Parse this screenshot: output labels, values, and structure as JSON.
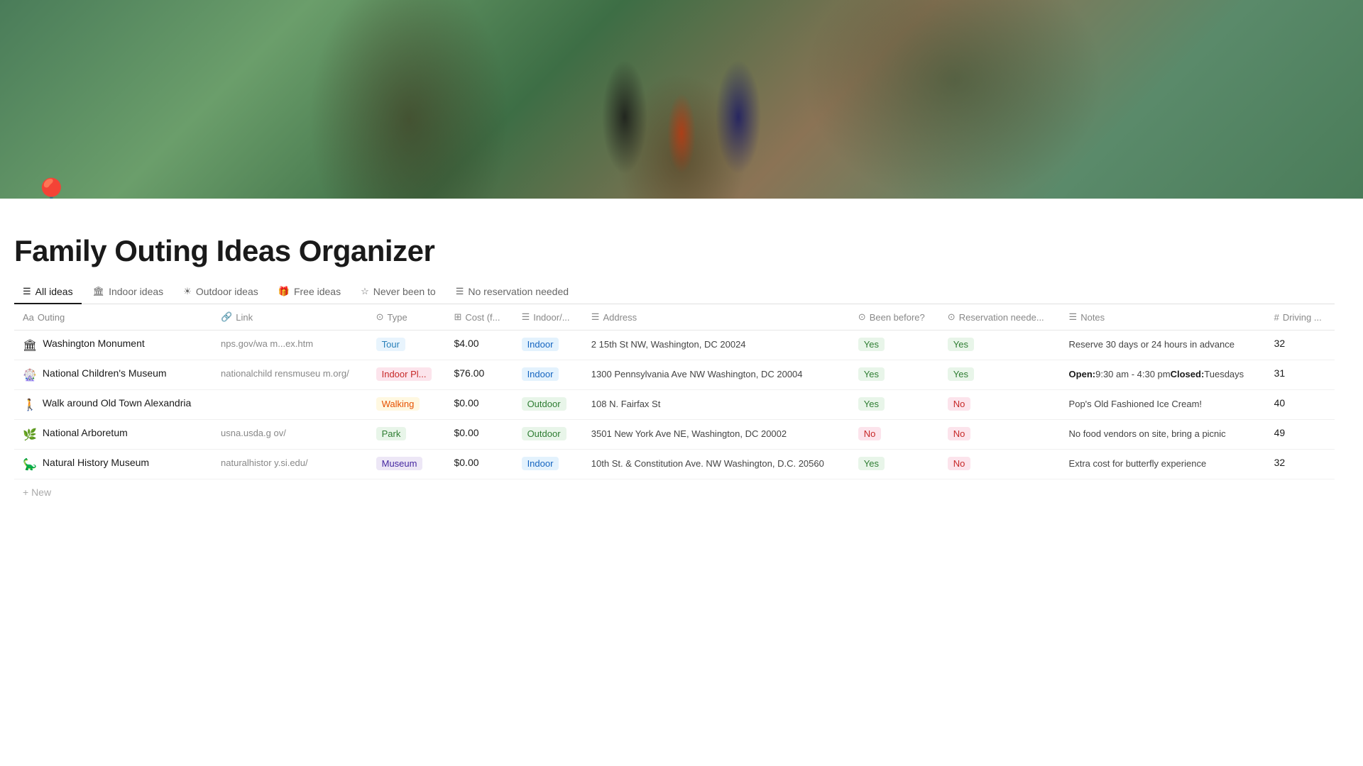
{
  "hero": {
    "alt": "Family walking on a trail"
  },
  "page": {
    "icon": "📍",
    "title": "Family Outing Ideas Organizer"
  },
  "tabs": [
    {
      "id": "all-ideas",
      "label": "All ideas",
      "icon": "☰",
      "active": true
    },
    {
      "id": "indoor-ideas",
      "label": "Indoor ideas",
      "icon": "🏛",
      "active": false
    },
    {
      "id": "outdoor-ideas",
      "label": "Outdoor ideas",
      "icon": "☀",
      "active": false
    },
    {
      "id": "free-ideas",
      "label": "Free ideas",
      "icon": "🎁",
      "active": false
    },
    {
      "id": "never-been-to",
      "label": "Never been to",
      "icon": "☆",
      "active": false
    },
    {
      "id": "no-reservation-needed",
      "label": "No reservation needed",
      "icon": "☰",
      "active": false
    }
  ],
  "columns": [
    {
      "id": "outing",
      "label": "Outing",
      "icon": "Aa"
    },
    {
      "id": "link",
      "label": "Link",
      "icon": "🔗"
    },
    {
      "id": "type",
      "label": "Type",
      "icon": "⊙"
    },
    {
      "id": "cost",
      "label": "Cost (f...",
      "icon": "⊞"
    },
    {
      "id": "indoor",
      "label": "Indoor/...",
      "icon": "☰"
    },
    {
      "id": "address",
      "label": "Address",
      "icon": "☰"
    },
    {
      "id": "been-before",
      "label": "Been before?",
      "icon": "⊙"
    },
    {
      "id": "reservation",
      "label": "Reservation neede...",
      "icon": "⊙"
    },
    {
      "id": "notes",
      "label": "Notes",
      "icon": "☰"
    },
    {
      "id": "driving",
      "label": "Driving ...",
      "icon": "#"
    }
  ],
  "rows": [
    {
      "outing": "Washington Monument",
      "outing_icon": "🏛",
      "link": "nps.gov/wa m...ex.htm",
      "link_url": "nps.gov/wamo/planyourvisit/permitsandreservations.htm",
      "type": "Tour",
      "type_class": "badge-tour",
      "cost": "$4.00",
      "indoor": "Indoor",
      "indoor_class": "badge-indoor",
      "address": "2 15th St NW, Washington, DC 20024",
      "been_before": "Yes",
      "been_before_class": "badge-yes",
      "reservation": "Yes",
      "reservation_class": "badge-yes",
      "notes": "Reserve 30 days or 24 hours in advance",
      "notes_html": "Reserve 30 days or 24 hours in advance",
      "driving": "32"
    },
    {
      "outing": "National Children's Museum",
      "outing_icon": "🎡",
      "link": "nationalchild rensmuseu m.org/",
      "link_url": "nationalchildrensmuseum.org/",
      "type": "Indoor Pl...",
      "type_class": "badge-indoor-pl",
      "cost": "$76.00",
      "indoor": "Indoor",
      "indoor_class": "badge-indoor",
      "address": "1300 Pennsylvania Ave NW Washington, DC 20004",
      "been_before": "Yes",
      "been_before_class": "badge-yes",
      "reservation": "Yes",
      "reservation_class": "badge-yes",
      "notes_html": "<strong>Open:</strong>9:30 am - 4:30 pm<strong>Closed:</strong>Tuesdays",
      "driving": "31"
    },
    {
      "outing": "Walk around Old Town Alexandria",
      "outing_icon": "🚶",
      "link": "",
      "link_url": "",
      "type": "Walking",
      "type_class": "badge-walking",
      "cost": "$0.00",
      "indoor": "Outdoor",
      "indoor_class": "badge-outdoor",
      "address": "108 N. Fairfax St",
      "been_before": "Yes",
      "been_before_class": "badge-yes",
      "reservation": "No",
      "reservation_class": "badge-no",
      "notes_html": "Pop's Old Fashioned Ice Cream!",
      "driving": "40"
    },
    {
      "outing": "National Arboretum",
      "outing_icon": "🌿",
      "link": "usna.usda.g ov/",
      "link_url": "usna.usda.gov/",
      "type": "Park",
      "type_class": "badge-park",
      "cost": "$0.00",
      "indoor": "Outdoor",
      "indoor_class": "badge-outdoor",
      "address": "3501 New York Ave NE, Washington, DC 20002",
      "been_before": "No",
      "been_before_class": "badge-no",
      "reservation": "No",
      "reservation_class": "badge-no",
      "notes_html": "No food vendors on site, bring a picnic",
      "driving": "49"
    },
    {
      "outing": "Natural History Museum",
      "outing_icon": "🦕",
      "link": "naturalhistor y.si.edu/",
      "link_url": "naturalhistory.si.edu/",
      "type": "Museum",
      "type_class": "badge-museum",
      "cost": "$0.00",
      "indoor": "Indoor",
      "indoor_class": "badge-indoor",
      "address": "10th St. & Constitution Ave. NW Washington, D.C. 20560",
      "been_before": "Yes",
      "been_before_class": "badge-yes",
      "reservation": "No",
      "reservation_class": "badge-no",
      "notes_html": "Extra cost for butterfly experience",
      "driving": "32"
    }
  ]
}
